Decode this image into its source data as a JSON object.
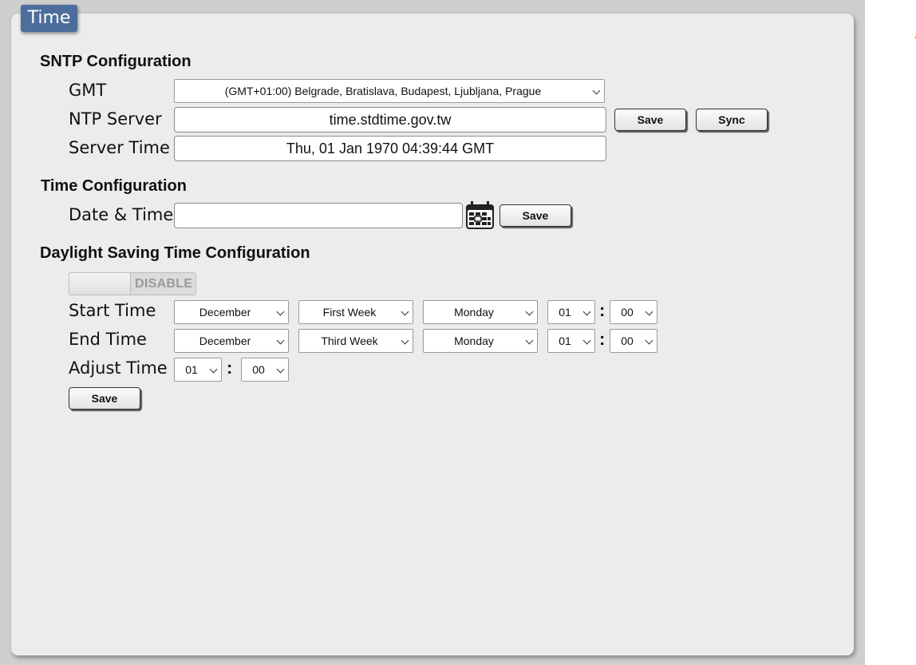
{
  "tab": {
    "title": "Time"
  },
  "sntp": {
    "title": "SNTP Configuration",
    "gmt_label": "GMT",
    "gmt_value": "(GMT+01:00) Belgrade, Bratislava, Budapest, Ljubljana, Prague",
    "ntp_label": "NTP Server",
    "ntp_value": "time.stdtime.gov.tw",
    "save_label": "Save",
    "sync_label": "Sync",
    "server_time_label": "Server Time",
    "server_time_value": "Thu, 01 Jan 1970 04:39:44 GMT"
  },
  "time_config": {
    "title": "Time Configuration",
    "date_time_label": "Date & Time",
    "date_time_value": "",
    "save_label": "Save",
    "calendar_icon": "calendar-icon"
  },
  "dst": {
    "title": "Daylight Saving Time Configuration",
    "toggle_label": "DISABLE",
    "start_label": "Start Time",
    "start": {
      "month": "December",
      "week": "First Week",
      "day": "Monday",
      "hour": "01",
      "minute": "00"
    },
    "end_label": "End Time",
    "end": {
      "month": "December",
      "week": "Third Week",
      "day": "Monday",
      "hour": "01",
      "minute": "00"
    },
    "adjust_label": "Adjust Time",
    "adjust": {
      "hour": "01",
      "minute": "00"
    },
    "colon": ":",
    "save_label": "Save"
  },
  "colors": {
    "tab_bg": "#4d6e9c",
    "panel_bg": "#ececec",
    "page_bg": "#cfcfcf"
  }
}
